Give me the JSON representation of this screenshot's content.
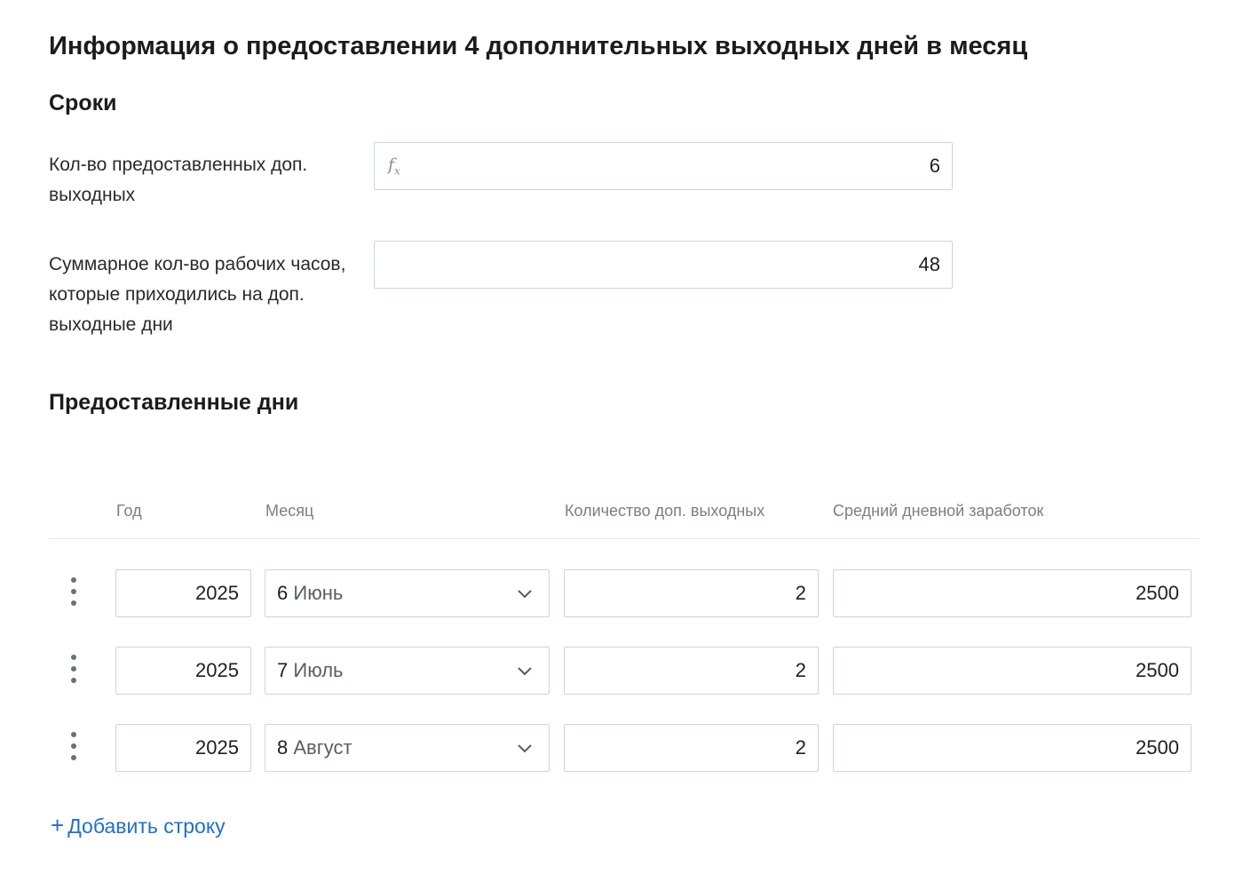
{
  "page": {
    "title": "Информация о предоставлении 4 дополнительных выходных дней в месяц"
  },
  "terms": {
    "title": "Сроки",
    "granted_days": {
      "label": "Кол-во предоставленных доп. выходных",
      "formula_icon": "fx-icon",
      "value": "6"
    },
    "total_hours": {
      "label": "Суммарное кол-во рабочих часов, которые приходились на доп. выходные дни",
      "value": "48"
    }
  },
  "granted": {
    "title": "Предоставленные дни",
    "columns": {
      "year": "Год",
      "month": "Месяц",
      "days": "Количество доп. выходных",
      "earnings": "Средний дневной заработок"
    },
    "rows": [
      {
        "year": "2025",
        "month_num": "6",
        "month_name": "Июнь",
        "days": "2",
        "earnings": "2500"
      },
      {
        "year": "2025",
        "month_num": "7",
        "month_name": "Июль",
        "days": "2",
        "earnings": "2500"
      },
      {
        "year": "2025",
        "month_num": "8",
        "month_name": "Август",
        "days": "2",
        "earnings": "2500"
      }
    ],
    "add_row": {
      "icon": "plus-icon",
      "label": "Добавить строку"
    }
  },
  "colors": {
    "accent": "#1f6fd1",
    "border": "#cfd3d8",
    "muted_text": "#7b7e82"
  }
}
